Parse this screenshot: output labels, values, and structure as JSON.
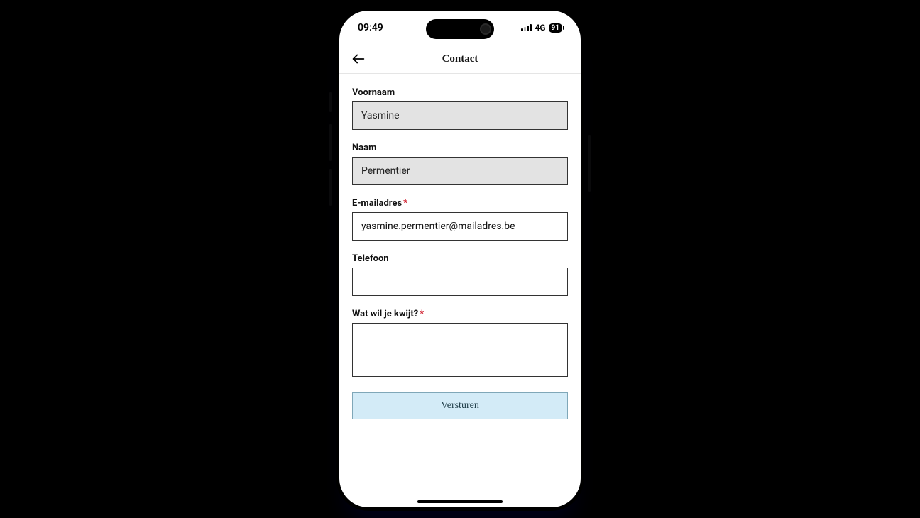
{
  "status": {
    "time": "09:49",
    "network": "4G",
    "battery": "91"
  },
  "nav": {
    "title": "Contact"
  },
  "form": {
    "firstname": {
      "label": "Voornaam",
      "value": "Yasmine"
    },
    "lastname": {
      "label": "Naam",
      "value": "Permentier"
    },
    "email": {
      "label": "E-mailadres",
      "value": "yasmine.permentier@mailadres.be",
      "required": true
    },
    "phone": {
      "label": "Telefoon",
      "value": ""
    },
    "message": {
      "label": "Wat wil je kwijt?",
      "value": "",
      "required": true
    },
    "submit_label": "Versturen"
  }
}
